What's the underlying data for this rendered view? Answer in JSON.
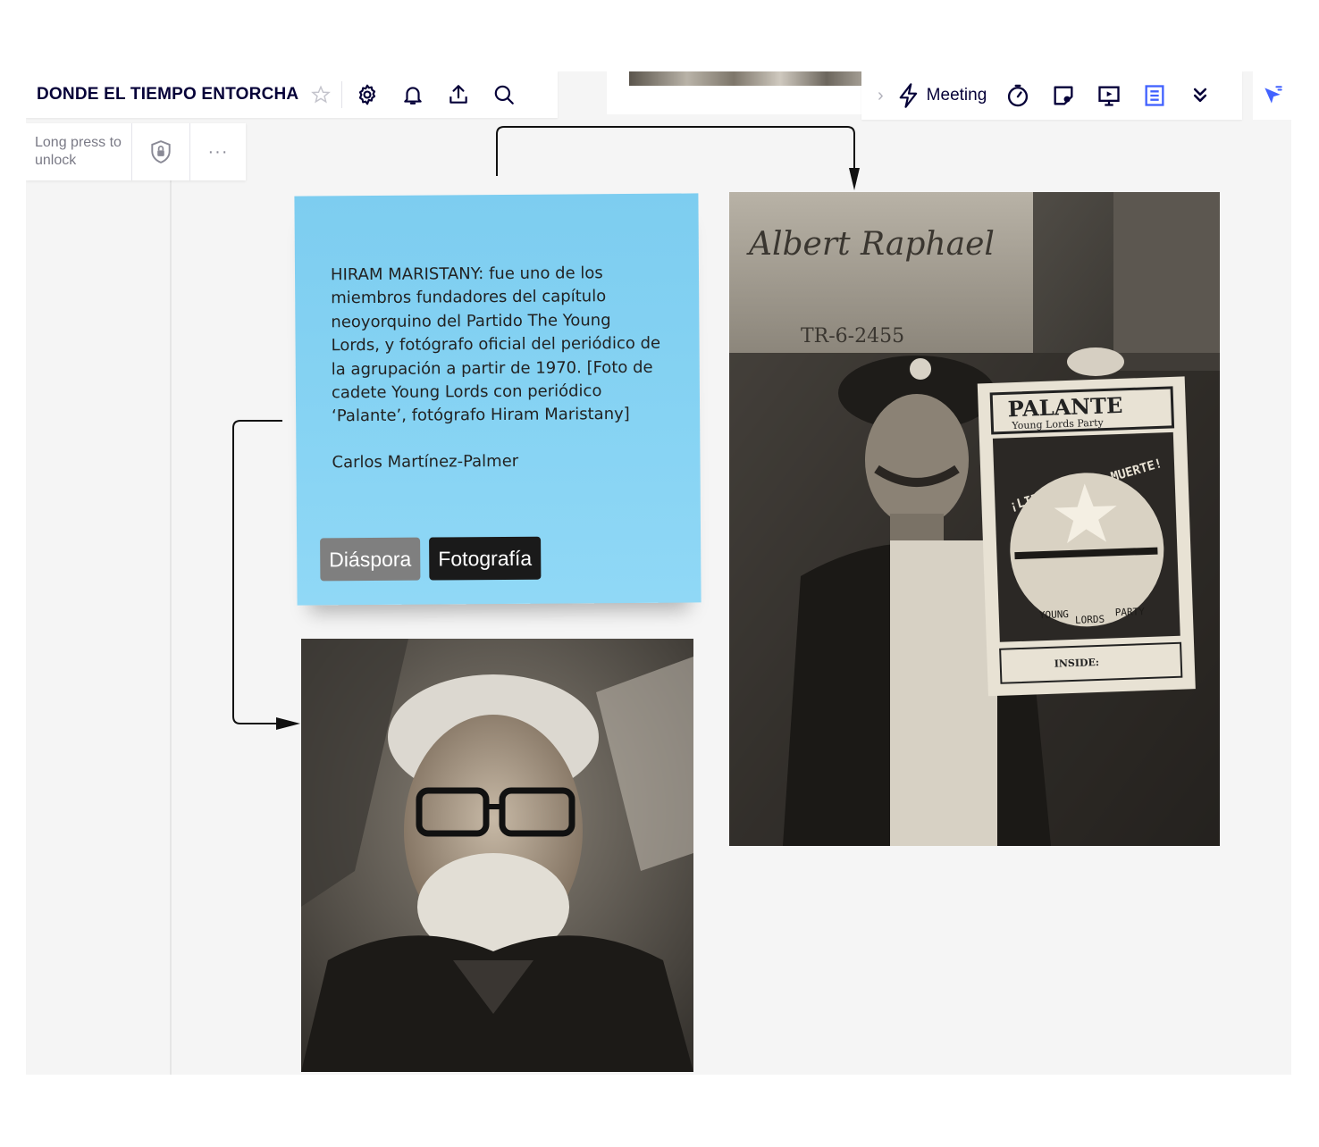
{
  "board": {
    "title": "DONDE EL TIEMPO ENTORCHA"
  },
  "toolbar_left": {
    "icons": [
      "star-icon",
      "gear-icon",
      "bell-icon",
      "upload-icon",
      "search-icon"
    ]
  },
  "lock_bar": {
    "text": "Long press to unlock",
    "more": "···"
  },
  "toolbar_right": {
    "meeting_label": "Meeting",
    "icons": [
      "timer-icon",
      "note-add-icon",
      "presentation-icon",
      "document-icon",
      "double-chevron-down-icon",
      "cursor-icon"
    ]
  },
  "sticky": {
    "text": "HIRAM MARISTANY: fue uno de los miembros fundadores del capítulo neoyorquino del Partido The Young Lords, y fotógrafo oficial del periódico de la agrupación a partir de 1970. [Foto de cadete Young Lords con periódico ‘Palante’, fotógrafo Hiram Maristany]",
    "author": "Carlos Martínez-Palmer",
    "tags": [
      "Diáspora",
      "Fotografía"
    ]
  },
  "photo_right": {
    "sign_text": "Albert Raphael",
    "sign_phone": "TR-6-2455",
    "newspaper_title": "PALANTE",
    "newspaper_subtitle": "Young Lords Party",
    "slogan": "¡LIBERACION O MUERTE!",
    "circle_left": "YOUNG",
    "circle_mid": "LORDS",
    "circle_right": "PARTY",
    "inside": "INSIDE:"
  },
  "colors": {
    "sticky": "#86d3f3",
    "title": "#050038",
    "accent": "#4262ff"
  }
}
